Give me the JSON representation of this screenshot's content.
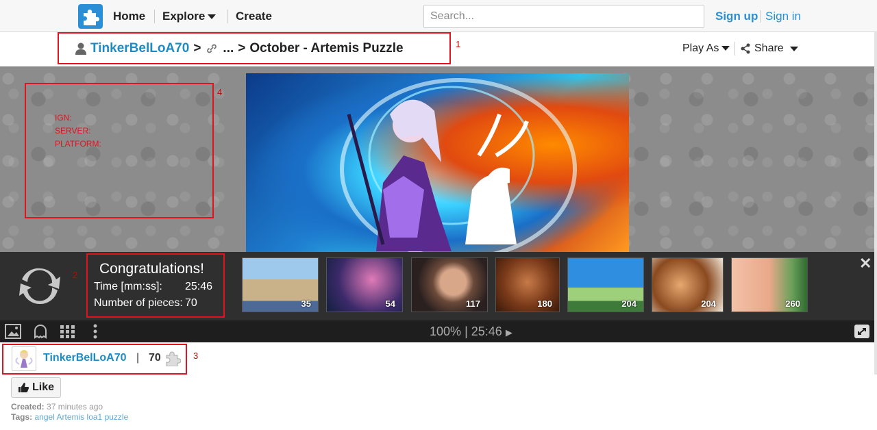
{
  "nav": {
    "home": "Home",
    "explore": "Explore",
    "create": "Create",
    "search_placeholder": "Search...",
    "signup": "Sign up",
    "signin": "Sign in"
  },
  "breadcrumb": {
    "user": "TinkerBelLoA70",
    "sep1": ">",
    "ellipsis": "...",
    "sep2": ">",
    "title": "October - Artemis Puzzle"
  },
  "labels": {
    "box1": "1",
    "box2": "2",
    "box3": "3",
    "box4": "4"
  },
  "actions": {
    "play_as": "Play As",
    "share": "Share"
  },
  "info_box": {
    "ign": "IGN:",
    "server": "SERVER:",
    "platform": "PLATFORM:"
  },
  "congrats": {
    "title": "Congratulations!",
    "time_label": "Time [mm:ss]:",
    "time_value": "25:46",
    "pieces_label": "Number of pieces:",
    "pieces_value": "70"
  },
  "thumbnails": [
    {
      "count": "35"
    },
    {
      "count": "54"
    },
    {
      "count": "117"
    },
    {
      "count": "180"
    },
    {
      "count": "204"
    },
    {
      "count": "204"
    },
    {
      "count": "260"
    }
  ],
  "toolbar": {
    "zoom": "100%",
    "divider": "|",
    "timer": "25:46"
  },
  "user": {
    "name": "TinkerBelLoA70",
    "divider": "|",
    "count": "70"
  },
  "like_label": "Like",
  "meta": {
    "created_label": "Created:",
    "created_value": "37 minutes ago",
    "tags_label": "Tags:",
    "tags": [
      "angel",
      "Artemis",
      "loa1",
      "puzzle"
    ]
  },
  "colors": {
    "accent": "#2a8fd6",
    "username": "#1e8bc3",
    "annotation": "#e0131f"
  }
}
